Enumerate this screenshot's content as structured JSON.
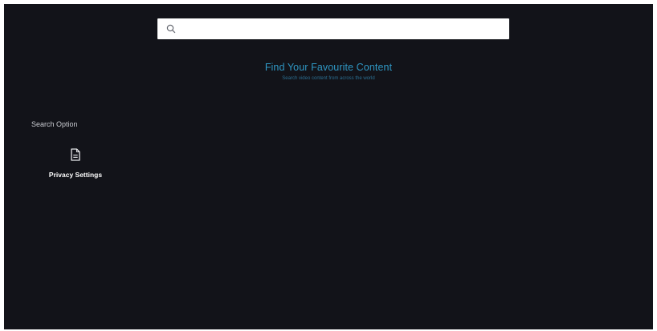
{
  "search": {
    "placeholder": "",
    "value": "",
    "icon": "search-icon"
  },
  "hero": {
    "title": "Find Your Favourite Content",
    "subtitle": "Search video content from across the world"
  },
  "sidebar": {
    "section_label": "Search Option",
    "items": [
      {
        "label": "Privacy Settings",
        "icon": "document-icon"
      }
    ]
  },
  "colors": {
    "background": "#121319",
    "accent": "#2f97c4",
    "search_bar": "#ffffff"
  }
}
